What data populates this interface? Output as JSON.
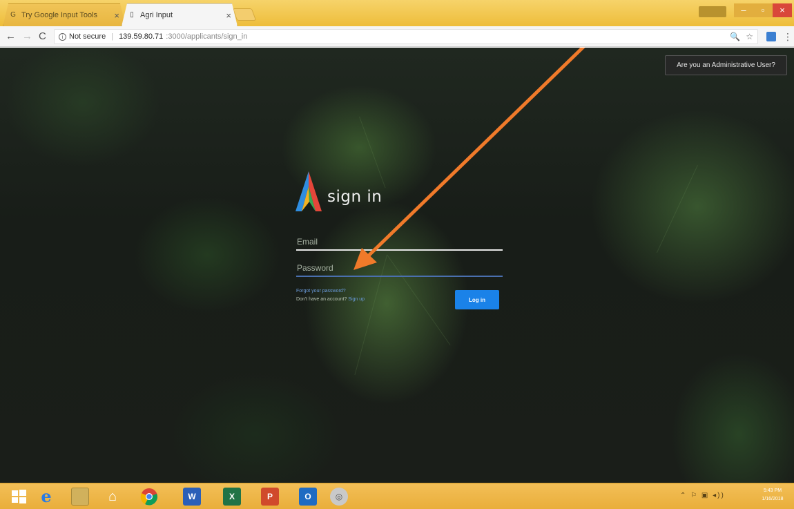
{
  "browser": {
    "tabs": [
      {
        "title": "Try Google Input Tools",
        "close": "×"
      },
      {
        "title": "Agri Input",
        "close": "×"
      }
    ],
    "window_controls": {
      "minimize": "–",
      "maximize": "▫",
      "close": "×"
    },
    "user_badge": "",
    "nav": {
      "back": "←",
      "forward": "→",
      "reload": "C"
    },
    "address": {
      "security": "Not secure",
      "host": "139.59.80.71",
      "path": ":3000/applicants/sign_in"
    },
    "omnibox_icons": {
      "zoom": "🔍",
      "star": "☆"
    },
    "menu": "⋮"
  },
  "page": {
    "admin_button": "Are you an Administrative User?",
    "title": "sign in",
    "email_placeholder": "Email",
    "password_placeholder": "Password",
    "forgot_link": "Forgot your password?",
    "signup_prefix": "Don't have an account? ",
    "signup_link": "Sign up",
    "login_button": "Log in",
    "colors": {
      "accent": "#1a82e8",
      "link": "#6b9cde",
      "annotation": "#f07a2a"
    }
  },
  "taskbar": {
    "icons": [
      "windows-start-icon",
      "internet-explorer-icon",
      "file-explorer-icon",
      "home-icon",
      "chrome-icon",
      "word-icon",
      "excel-icon",
      "powerpoint-icon",
      "outlook-icon",
      "app-icon"
    ],
    "labels": {
      "word": "W",
      "excel": "X",
      "ppt": "P",
      "outlook": "O"
    },
    "clock_time": "5:43 PM",
    "clock_date": "1/16/2018"
  }
}
